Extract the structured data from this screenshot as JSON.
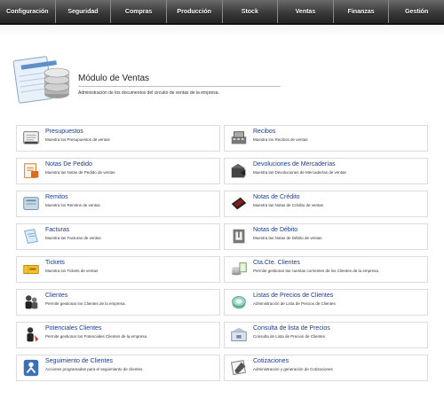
{
  "nav": {
    "items": [
      "Configuración",
      "Seguridad",
      "Compras",
      "Producción",
      "Stock",
      "Ventas",
      "Finanzas",
      "Gestión"
    ]
  },
  "module": {
    "title": "Módulo de Ventas",
    "description": "Administración de los documentos del circuito de ventas de la empresa."
  },
  "cards": [
    {
      "title": "Presupuestos",
      "desc": "Muestra los Presupuestos de ventas",
      "icon": "notebook-icon"
    },
    {
      "title": "Recibos",
      "desc": "Muestra los Recibos de ventas",
      "icon": "cash-register-icon"
    },
    {
      "title": "Notas De Pedido",
      "desc": "Muestra las Notas de Pedido de ventas",
      "icon": "order-notes-icon"
    },
    {
      "title": "Devoluciones de Mercaderías",
      "desc": "Muestra las Devoluciones de Mercaderías de ventas",
      "icon": "returned-box-icon"
    },
    {
      "title": "Remitos",
      "desc": "Muestra los Remitos de ventas",
      "icon": "delivery-note-icon"
    },
    {
      "title": "Notas de Crédito",
      "desc": "Muestra las Notas de Crédito de ventas",
      "icon": "credit-card-icon"
    },
    {
      "title": "Facturas",
      "desc": "Muestra las Facturas de ventas",
      "icon": "invoice-icon"
    },
    {
      "title": "Notas de Débito",
      "desc": "Muestra las Notas de Débito de ventas",
      "icon": "debit-note-icon"
    },
    {
      "title": "Tickets",
      "desc": "Muestra los Tickets de ventas",
      "icon": "ticket-icon"
    },
    {
      "title": "Cta.Cte. Clientes",
      "desc": "Permite gestionar las cuentas corrientes de los Clientes de la empresa.",
      "icon": "coins-icon"
    },
    {
      "title": "Clientes",
      "desc": "Permite gestionar los Clientes de la empresa.",
      "icon": "clients-icon"
    },
    {
      "title": "Listas de Precios de Clientes",
      "desc": "Administración de Lista de Precios de Clientes",
      "icon": "price-list-icon"
    },
    {
      "title": "Potenciales Clientes",
      "desc": "Permite gestionar los Potenciales Clientes de la empresa.",
      "icon": "potential-clients-icon"
    },
    {
      "title": "Consulta de lista de Precios",
      "desc": "Consulta de Lista de Precios de Clientes",
      "icon": "price-query-icon"
    },
    {
      "title": "Seguimiento de Clientes",
      "desc": "Acciones programadas para el seguimiento de clientes.",
      "icon": "client-followup-icon"
    },
    {
      "title": "Cotizaciones",
      "desc": "Administración y generación de Cotizaciones",
      "icon": "quotes-icon"
    }
  ]
}
